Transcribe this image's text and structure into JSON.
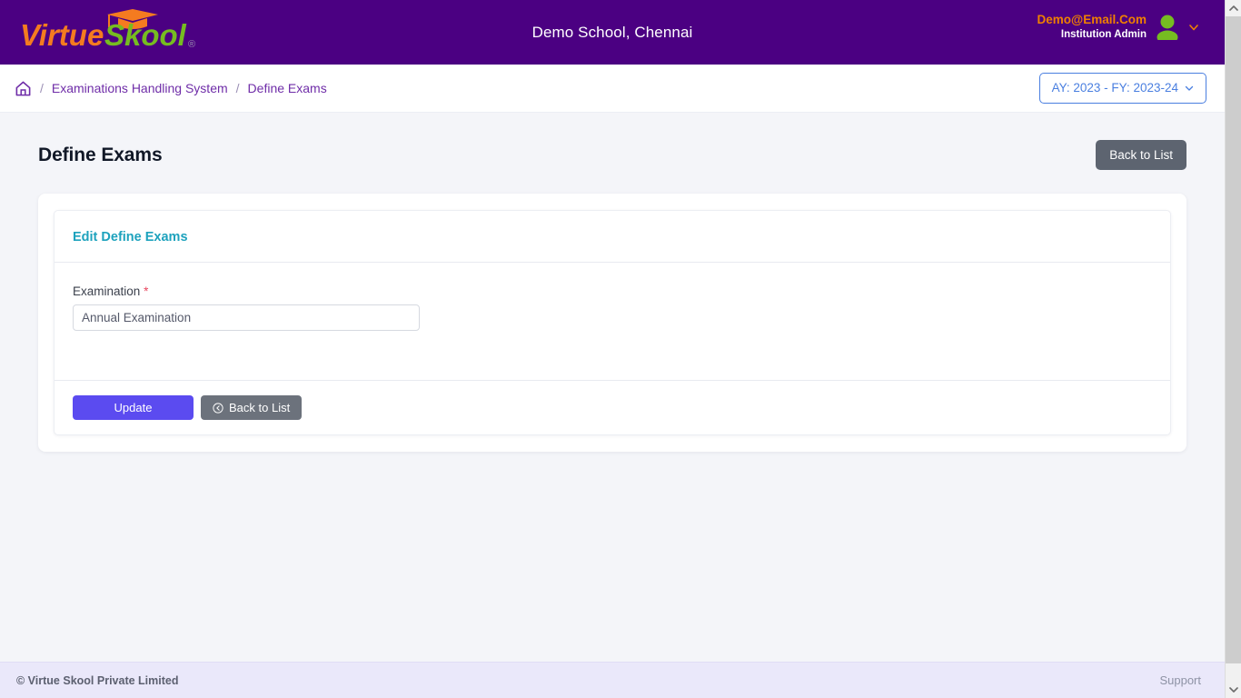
{
  "colors": {
    "header_bg": "#4b0082",
    "brand_orange": "#f47b20",
    "brand_green": "#76bc21",
    "accent_email": "#f08000",
    "breadcrumb_purple": "#6f2da8",
    "ay_blue": "#4a7fe0",
    "card_title_teal": "#1da2bd",
    "update_indigo": "#5b4bf0",
    "gray_button": "#5d6470",
    "required_red": "#e8485f",
    "footer_bg": "#eae8fa",
    "page_bg": "#f4f5f9"
  },
  "header": {
    "logo_text_part1": "Virtue",
    "logo_text_part2": "Skool",
    "logo_registered": "®",
    "logo_icon": "graduation-cap-icon",
    "school_name": "Demo School, Chennai",
    "user_email": "Demo@Email.Com",
    "user_role": "Institution Admin",
    "avatar_icon": "user-avatar-icon",
    "caret_icon": "chevron-down-icon"
  },
  "breadcrumb": {
    "home_icon": "home-icon",
    "separator": "/",
    "items": [
      {
        "label": "Examinations Handling System",
        "current": false
      },
      {
        "label": "Define Exams",
        "current": true
      }
    ],
    "academic_year": {
      "label": "AY: 2023 - FY: 2023-24",
      "caret_icon": "chevron-down-icon"
    }
  },
  "page": {
    "title": "Define Exams",
    "back_to_list_label": "Back to List"
  },
  "card": {
    "title": "Edit Define Exams",
    "form": {
      "fields": [
        {
          "label": "Examination",
          "required_marker": "*",
          "value": "Annual Examination",
          "placeholder": "Examination"
        }
      ],
      "actions": {
        "submit_label": "Update",
        "back_label": "Back to List",
        "back_icon": "arrow-circle-left-icon"
      }
    }
  },
  "footer": {
    "copyright": "© Virtue Skool Private Limited",
    "support_label": "Support"
  },
  "scrollbar": {
    "up_icon": "chevron-up-icon",
    "down_icon": "chevron-down-icon"
  }
}
